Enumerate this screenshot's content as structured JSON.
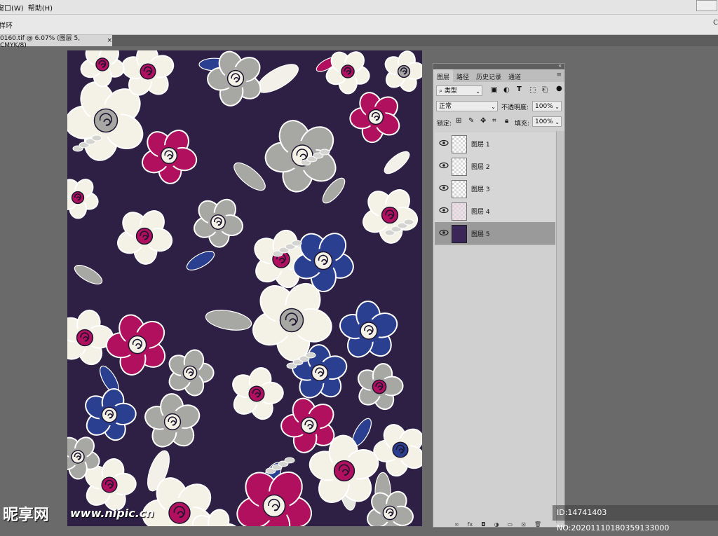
{
  "menu": {
    "items": [
      "窗口(W)",
      "帮助(H)"
    ]
  },
  "options_bar": {
    "label": "样环"
  },
  "document_tab": {
    "title": "0160.tif @ 6.07% (图层 5, CMYK/8)",
    "close": "×"
  },
  "layers_panel": {
    "tabs": [
      "图层",
      "路径",
      "历史记录",
      "通道"
    ],
    "filter": {
      "value": "类型"
    },
    "blend_mode": {
      "value": "正常"
    },
    "opacity": {
      "label": "不透明度:",
      "value": "100%"
    },
    "lock": {
      "label": "锁定:"
    },
    "fill": {
      "label": "填充:",
      "value": "100%"
    },
    "layers": [
      {
        "name": "图层 1",
        "visible": true,
        "selected": false,
        "thumb": "transparent"
      },
      {
        "name": "图层 2",
        "visible": true,
        "selected": false,
        "thumb": "transparent"
      },
      {
        "name": "图层 3",
        "visible": true,
        "selected": false,
        "thumb": "transparent"
      },
      {
        "name": "图层 4",
        "visible": true,
        "selected": false,
        "thumb": "floral-pink"
      },
      {
        "name": "图层 5",
        "visible": true,
        "selected": true,
        "thumb": "dark-purple"
      }
    ],
    "bottom_icons": [
      "link-icon",
      "fx-icon",
      "mask-icon",
      "adjustment-icon",
      "group-icon",
      "new-layer-icon",
      "trash-icon"
    ]
  },
  "canvas": {
    "background": "#2e1f45",
    "colors": {
      "magenta": "#b0105e",
      "navy": "#2a3f8f",
      "gray": "#a7a7a3",
      "cream": "#f4f1e6",
      "dark": "#2e1f45"
    }
  },
  "watermark": {
    "logo_text": "昵享网",
    "url": "www.nipic.cn",
    "id_text": "ID:14741403 NO:20201110180359133000"
  }
}
